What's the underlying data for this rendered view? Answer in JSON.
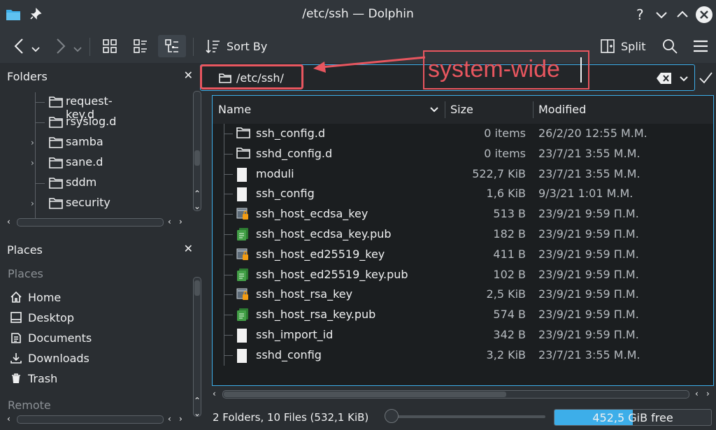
{
  "window": {
    "title": "/etc/ssh — Dolphin",
    "buttons": [
      "help-icon",
      "minimize-icon",
      "maximize-icon",
      "close-icon"
    ]
  },
  "toolbar": {
    "sort_label": "Sort By",
    "split_label": "Split"
  },
  "folders_panel": {
    "title": "Folders",
    "items": [
      {
        "label": "request-key.d",
        "expandable": false
      },
      {
        "label": "rsyslog.d",
        "expandable": false
      },
      {
        "label": "samba",
        "expandable": true
      },
      {
        "label": "sane.d",
        "expandable": true
      },
      {
        "label": "sddm",
        "expandable": false
      },
      {
        "label": "security",
        "expandable": true
      }
    ]
  },
  "places_panel": {
    "title": "Places",
    "section_label": "Places",
    "items": [
      {
        "label": "Home",
        "icon": "home-icon"
      },
      {
        "label": "Desktop",
        "icon": "desktop-icon"
      },
      {
        "label": "Documents",
        "icon": "documents-icon"
      },
      {
        "label": "Downloads",
        "icon": "downloads-icon"
      },
      {
        "label": "Trash",
        "icon": "trash-icon"
      }
    ],
    "remote_label": "Remote"
  },
  "location": {
    "path": "/etc/ssh/"
  },
  "annotation": {
    "text": "system-wide",
    "color": "#e8565f"
  },
  "columns": {
    "name": "Name",
    "size": "Size",
    "modified": "Modified"
  },
  "files": [
    {
      "name": "ssh_config.d",
      "size": "0 items",
      "modified": "26/2/20 12:55 Μ.Μ.",
      "kind": "folder"
    },
    {
      "name": "sshd_config.d",
      "size": "0 items",
      "modified": "23/7/21 3:55 Μ.Μ.",
      "kind": "folder"
    },
    {
      "name": "moduli",
      "size": "522,7 KiB",
      "modified": "23/7/21 3:55 Μ.Μ.",
      "kind": "file"
    },
    {
      "name": "ssh_config",
      "size": "1,6 KiB",
      "modified": "9/3/21 1:01 Μ.Μ.",
      "kind": "file"
    },
    {
      "name": "ssh_host_ecdsa_key",
      "size": "513 B",
      "modified": "23/9/21 9:59 Π.Μ.",
      "kind": "key"
    },
    {
      "name": "ssh_host_ecdsa_key.pub",
      "size": "182 B",
      "modified": "23/9/21 9:59 Π.Μ.",
      "kind": "pub"
    },
    {
      "name": "ssh_host_ed25519_key",
      "size": "411 B",
      "modified": "23/9/21 9:59 Π.Μ.",
      "kind": "key"
    },
    {
      "name": "ssh_host_ed25519_key.pub",
      "size": "102 B",
      "modified": "23/9/21 9:59 Π.Μ.",
      "kind": "pub"
    },
    {
      "name": "ssh_host_rsa_key",
      "size": "2,5 KiB",
      "modified": "23/9/21 9:59 Π.Μ.",
      "kind": "key"
    },
    {
      "name": "ssh_host_rsa_key.pub",
      "size": "574 B",
      "modified": "23/9/21 9:59 Π.Μ.",
      "kind": "pub"
    },
    {
      "name": "ssh_import_id",
      "size": "342 B",
      "modified": "23/9/21 9:59 Π.Μ.",
      "kind": "file"
    },
    {
      "name": "sshd_config",
      "size": "3,2 KiB",
      "modified": "23/7/21 3:55 Μ.Μ.",
      "kind": "file"
    }
  ],
  "status": {
    "summary": "2 Folders, 10 Files (532,1 KiB)",
    "free_space": "452,5 GiB free",
    "used_fraction": 0.5
  },
  "colors": {
    "accent": "#3daee9",
    "background": "#2a2e32",
    "view_background": "#1b1e20"
  }
}
